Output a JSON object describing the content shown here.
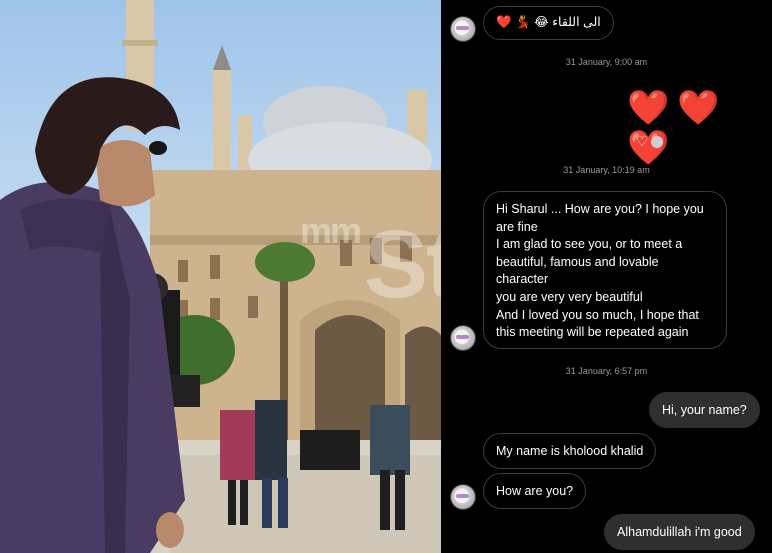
{
  "chat": {
    "messages": [
      {
        "type": "in",
        "text": "الى اللقاء 😂 💃 ❤️"
      },
      {
        "type": "stamp",
        "text": "31 January, 9:00 am"
      },
      {
        "type": "out_hearts",
        "text": "❤️❤️❤️"
      },
      {
        "type": "reaction",
        "text": "♡"
      },
      {
        "type": "stamp",
        "text": "31 January, 10:19 am"
      },
      {
        "type": "in",
        "lines": [
          "Hi Sharul ... How are you? I hope you",
          "are fine",
          "I am glad to see you, or to meet a",
          "beautiful, famous and lovable",
          "character",
          "you are very very beautiful",
          "And I loved you so much, I hope that",
          "this meeting will be repeated again"
        ]
      },
      {
        "type": "stamp",
        "text": "31 January, 6:57 pm"
      },
      {
        "type": "out",
        "text": "Hi, your name?"
      },
      {
        "type": "in",
        "text": "My name is kholood khalid"
      },
      {
        "type": "in",
        "text": "How are you?"
      },
      {
        "type": "out",
        "text": "Alhamdulillah i'm good"
      }
    ]
  },
  "watermark": {
    "text": "Star",
    "prefix": "mm"
  }
}
